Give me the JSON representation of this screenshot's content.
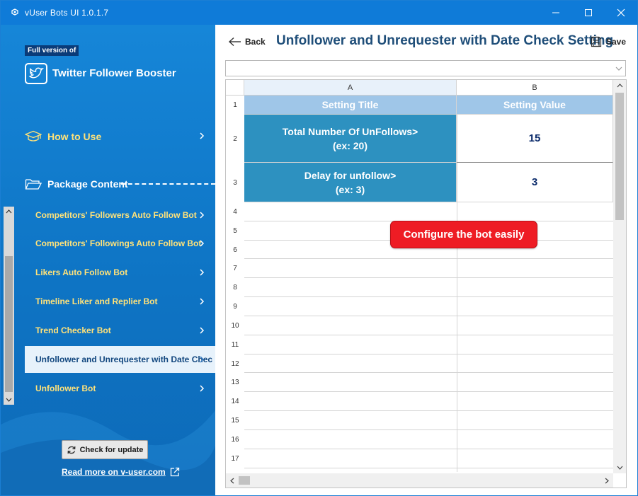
{
  "window": {
    "title": "vUser Bots UI 1.0.1.7",
    "controls": {
      "minimize": "minimize-icon",
      "maximize": "maximize-icon",
      "close": "close-icon"
    }
  },
  "sidebar": {
    "badge": "Full version of",
    "brand_title": "Twitter Follower Booster",
    "how_to_use": "How to Use",
    "package_content": "Package Content",
    "items": [
      {
        "label": "Competitors' Followers Auto Follow Bot",
        "active": false
      },
      {
        "label": "Competitors' Followings Auto Follow Bot",
        "active": false
      },
      {
        "label": "Likers Auto Follow Bot",
        "active": false
      },
      {
        "label": "Timeline Liker and Replier Bot",
        "active": false
      },
      {
        "label": "Trend Checker Bot",
        "active": false
      },
      {
        "label": "Unfollower and Unrequester with Date Chec",
        "active": true
      },
      {
        "label": "Unfollower Bot",
        "active": false
      }
    ],
    "check_update_label": "Check for update",
    "read_more_label": "Read more on v-user.com"
  },
  "main": {
    "back_label": "Back",
    "title": "Unfollower and Unrequester with Date Check Setting",
    "save_label": "Save",
    "combo_value": ""
  },
  "sheet": {
    "columns": [
      "A",
      "B"
    ],
    "row_numbers": [
      "1",
      "2",
      "3",
      "4",
      "5",
      "6",
      "7",
      "8",
      "9",
      "10",
      "11",
      "12",
      "13",
      "14",
      "15",
      "16",
      "17"
    ],
    "header": {
      "title": "Setting Title",
      "value": "Setting Value"
    },
    "settings": [
      {
        "title_line1": "Total Number Of UnFollows>",
        "title_line2": "(ex: 20)",
        "value": "15"
      },
      {
        "title_line1": "Delay for unfollow>",
        "title_line2": "(ex: 3)",
        "value": "3"
      }
    ]
  },
  "callout": "Configure the bot easily",
  "colors": {
    "titlebar": "#0f7bd8",
    "sidebar": "#1380d2",
    "nav_text": "#ffe27a",
    "header_cell": "#9fc6e8",
    "title_cell": "#2d91c0",
    "value_text": "#0b2b6b",
    "callout": "#ee1c24",
    "page_title": "#1f4e79"
  }
}
